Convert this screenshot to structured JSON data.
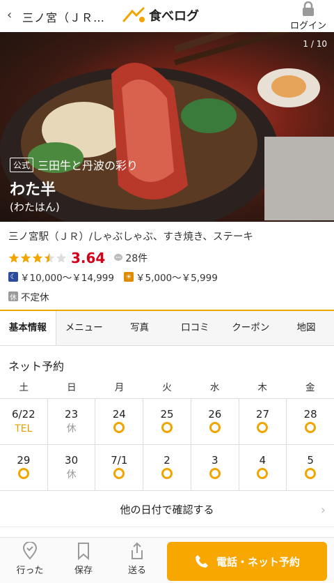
{
  "header": {
    "back_icon": "chevron-left-icon",
    "breadcrumb": "三ノ宮（ＪＲ…",
    "logo_text": "食べログ",
    "login_label": "ログイン",
    "login_icon": "lock-icon"
  },
  "hero": {
    "counter": "1 / 10",
    "official_badge": "公式",
    "tagline": "三田牛と丹波の彩り",
    "name": "わた半",
    "kana": "(わたはん)"
  },
  "info": {
    "genre": "三ノ宮駅（ＪＲ）/しゃぶしゃぶ、すき焼き、ステーキ",
    "rating_stars": 3.5,
    "score": "3.64",
    "review_count": "28件",
    "dinner_price": "￥10,000～￥14,999",
    "lunch_price": "￥5,000～￥5,999",
    "closed_badge": "休",
    "closed_text": "不定休"
  },
  "tabs": [
    "基本情報",
    "メニュー",
    "写真",
    "口コミ",
    "クーポン",
    "地図"
  ],
  "reservation": {
    "title": "ネット予約",
    "weekdays": [
      "土",
      "日",
      "月",
      "火",
      "水",
      "木",
      "金"
    ],
    "rows": [
      [
        {
          "date": "6/22",
          "status": "TEL",
          "kind": "sat"
        },
        {
          "date": "23",
          "status": "休",
          "kind": "sun"
        },
        {
          "date": "24",
          "status": "ring",
          "kind": "normal"
        },
        {
          "date": "25",
          "status": "ring",
          "kind": "normal"
        },
        {
          "date": "26",
          "status": "ring",
          "kind": "normal"
        },
        {
          "date": "27",
          "status": "ring",
          "kind": "normal"
        },
        {
          "date": "28",
          "status": "ring",
          "kind": "normal"
        }
      ],
      [
        {
          "date": "29",
          "status": "ring",
          "kind": "sat"
        },
        {
          "date": "30",
          "status": "休",
          "kind": "sun"
        },
        {
          "date": "7/1",
          "status": "ring",
          "kind": "normal"
        },
        {
          "date": "2",
          "status": "ring",
          "kind": "normal"
        },
        {
          "date": "3",
          "status": "ring",
          "kind": "normal"
        },
        {
          "date": "4",
          "status": "ring",
          "kind": "normal"
        },
        {
          "date": "5",
          "status": "ring",
          "kind": "normal"
        }
      ]
    ],
    "other_dates_label": "他の日付で確認する"
  },
  "bottom_bar": {
    "went_label": "行った",
    "save_label": "保存",
    "share_label": "送る",
    "cta_label": "電話・ネット予約"
  },
  "colors": {
    "accent": "#f7a700",
    "score": "#d0021b",
    "saturday": "#2266aa",
    "sunday": "#c0392b"
  }
}
